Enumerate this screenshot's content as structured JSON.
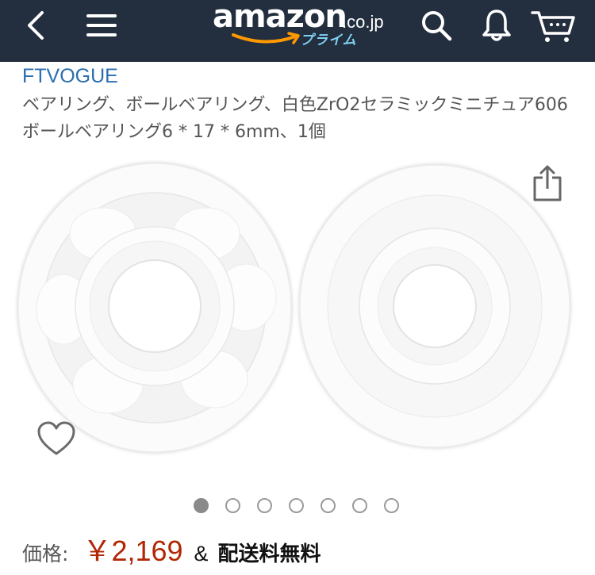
{
  "header": {
    "logo_word": "amazon",
    "logo_tld": ".co.jp",
    "logo_sub": "プライム",
    "icons": [
      "back-icon",
      "menu-icon",
      "search-icon",
      "bell-icon",
      "cart-icon"
    ],
    "background": "#232f3e"
  },
  "product": {
    "brand": "FTVOGUE",
    "title": "ベアリング、ボールベアリング、白色ZrO2セラミックミニチュア606ボールベアリング6 * 17 * 6mm、1個",
    "image_count": 7,
    "active_image": 1
  },
  "price": {
    "label": "価格:",
    "value": "￥2,169",
    "amp": "&",
    "shipping": "配送料無料"
  },
  "colors": {
    "brand_link": "#2a6fb0",
    "price": "#b12704"
  }
}
